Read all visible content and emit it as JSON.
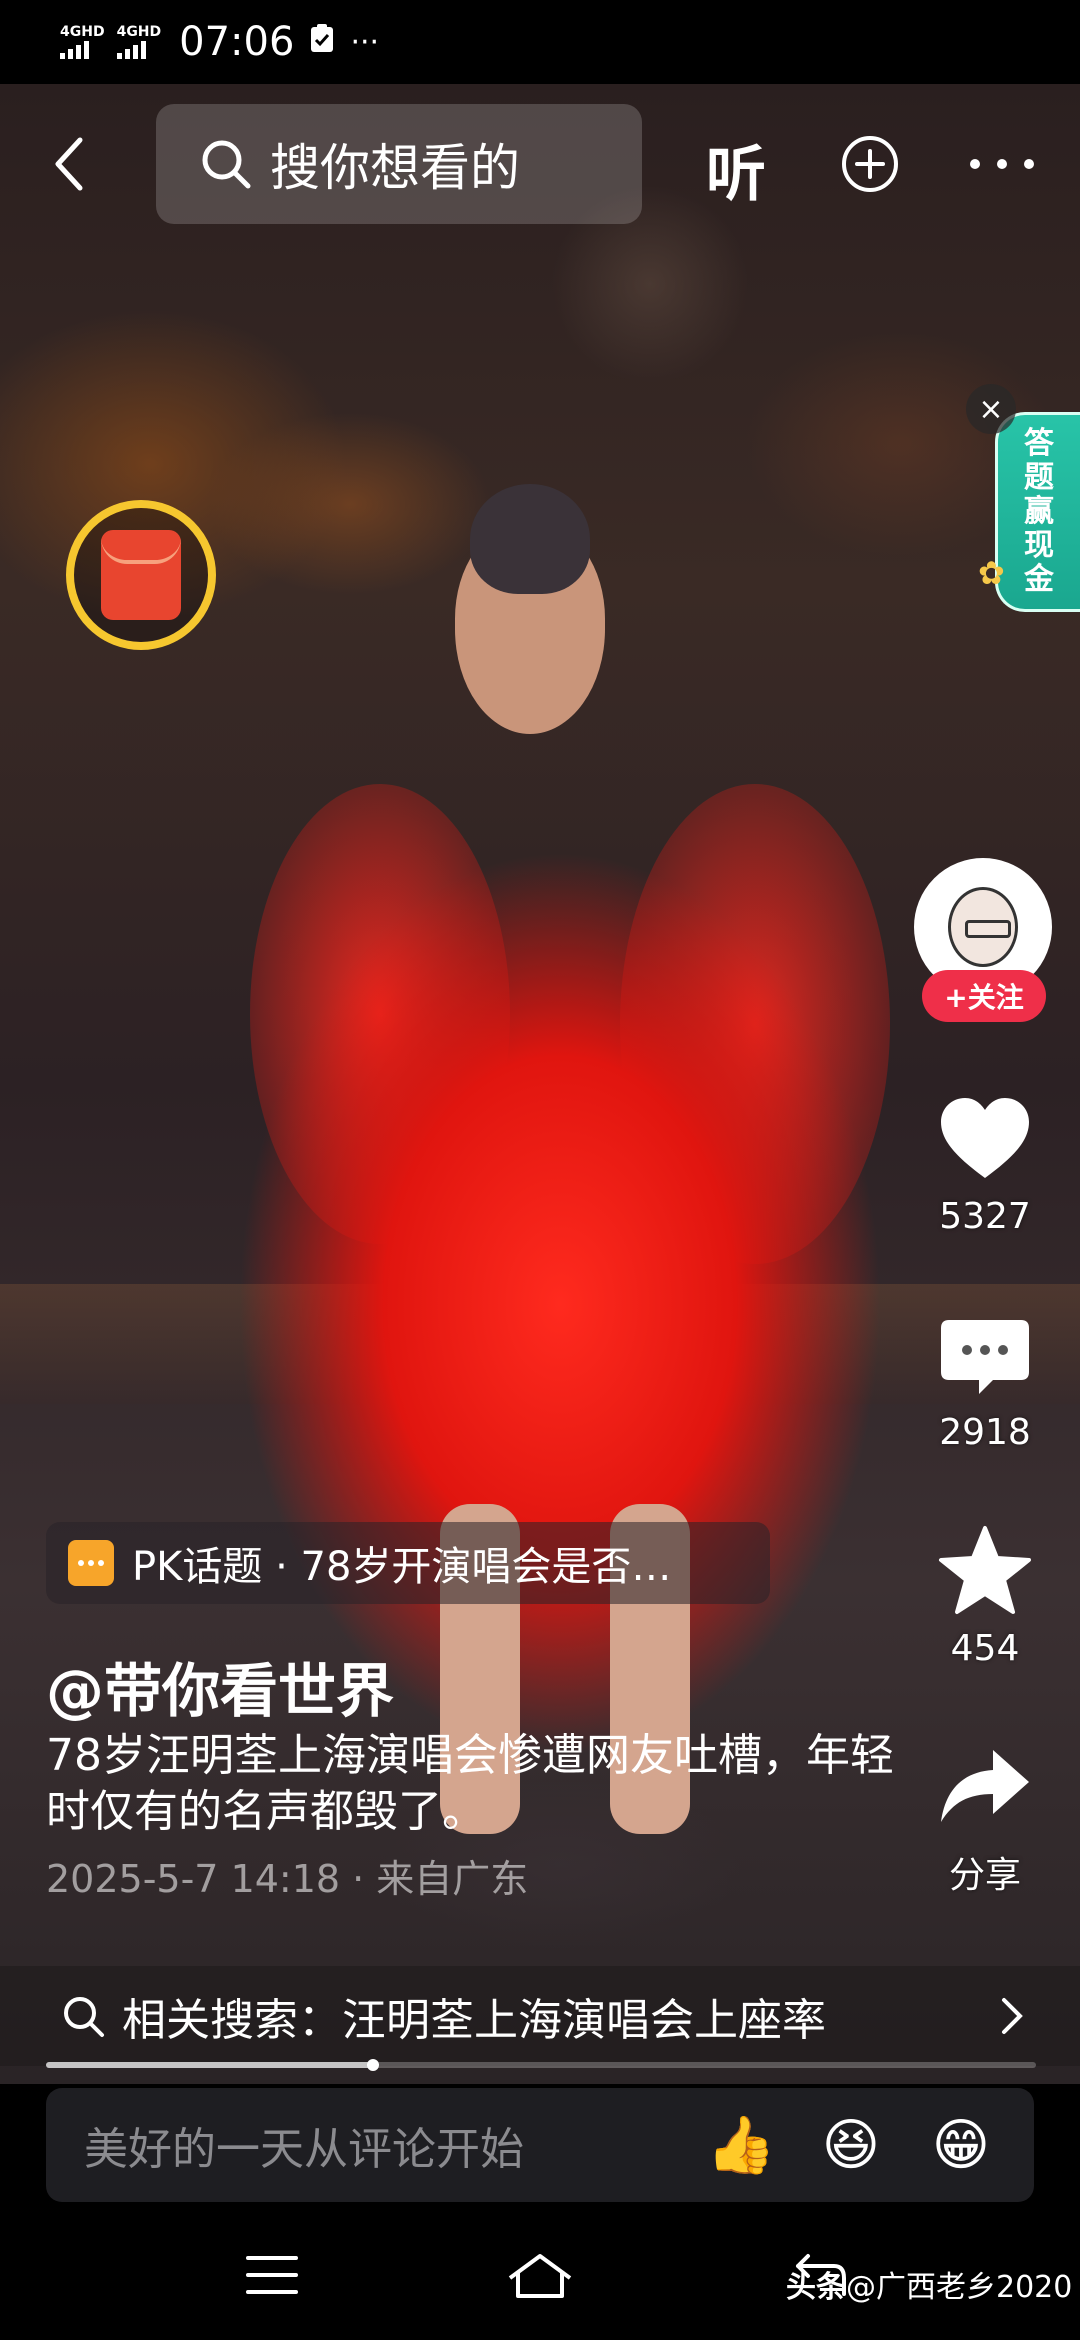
{
  "status_bar": {
    "signal_1": "4GHD",
    "signal_2": "4GHD",
    "time": "07:06",
    "notification_icon": "clipboard-check-icon",
    "overflow": "···"
  },
  "top_bar": {
    "back_icon": "chevron-left-icon",
    "search_placeholder": "搜你想看的",
    "listen_label": "听",
    "add_icon": "plus-circle-icon",
    "more_icon": "more-dots-icon"
  },
  "quiz_banner": {
    "label_chars": [
      "答",
      "题",
      "赢",
      "现",
      "金"
    ],
    "close": "×"
  },
  "right_rail": {
    "follow_label": "+关注",
    "like_count": "5327",
    "comment_count": "2918",
    "favorite_count": "454",
    "share_label": "分享"
  },
  "pk_topic": {
    "text": "PK话题 · 78岁开演唱会是否…"
  },
  "caption": {
    "author": "@带你看世界",
    "description": "78岁汪明荃上海演唱会惨遭网友吐槽，年轻时仅有的名声都毁了。",
    "meta": "2025-5-7 14:18 · 来自广东"
  },
  "related_search": {
    "text": "相关搜索：汪明荃上海演唱会上座率"
  },
  "playback": {
    "progress_fraction": 0.33
  },
  "comment_bar": {
    "placeholder": "美好的一天从评论开始",
    "emoji_1": "👍",
    "emoji_2": "😆",
    "emoji_3": "😁"
  },
  "watermark": {
    "brand": "头条",
    "handle": "@广西老乡2020"
  },
  "colors": {
    "follow_button": "#ef2f49",
    "quiz_banner": "#1aa78f",
    "red_packet_ring": "#f6c72f",
    "pk_icon": "#f7a52a"
  }
}
